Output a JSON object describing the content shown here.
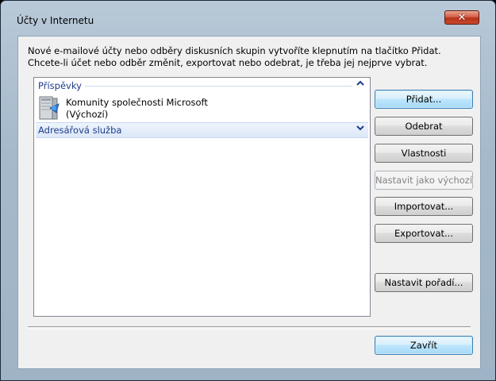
{
  "window": {
    "title": "Účty v Internetu",
    "close_glyph": "✕"
  },
  "description": {
    "line1": "Nové e-mailové účty nebo odběry diskusních skupin vytvoříte klepnutím na tlačítko Přidat.",
    "line2": "Chcete-li účet nebo odběr změnit, exportovat nebo odebrat, je třeba jej nejprve vybrat."
  },
  "list": {
    "groups": [
      {
        "label": "Příspěvky",
        "expanded": true,
        "chevron": "⌃",
        "items": [
          {
            "name": "Komunity společnosti Microsoft",
            "sub": "(Výchozí)",
            "icon": "news-server-icon"
          }
        ]
      },
      {
        "label": "Adresářová služba",
        "expanded": false,
        "chevron": "⌄",
        "items": []
      }
    ]
  },
  "buttons": {
    "add": "Přidat...",
    "remove": "Odebrat",
    "properties": "Vlastnosti",
    "set_default": "Nastavit jako výchozí",
    "import": "Importovat...",
    "export": "Exportovat...",
    "set_order": "Nastavit pořadí...",
    "close": "Zavřít"
  },
  "colors": {
    "group_header": "#1e3c8c",
    "default_button_border": "#3c7fb1"
  }
}
